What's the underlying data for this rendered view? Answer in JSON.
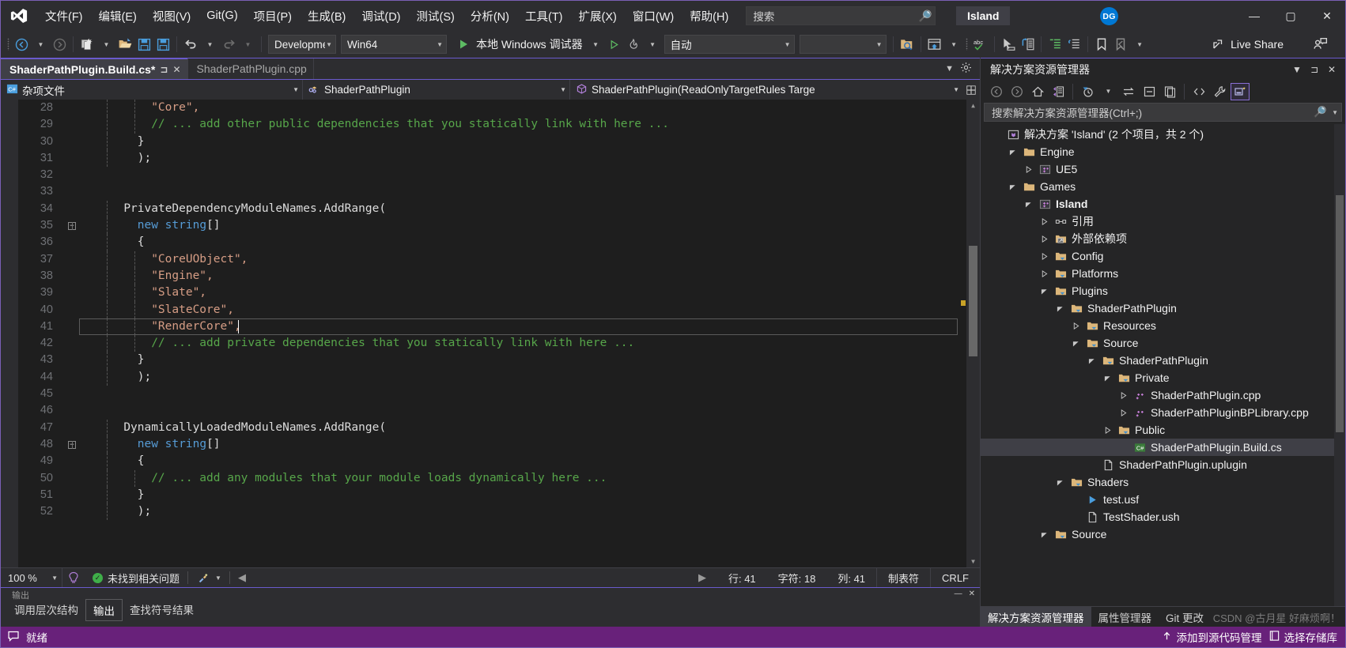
{
  "window": {
    "project_chip": "Island",
    "avatar_initials": "DG",
    "minimize": "—",
    "maximize": "▢",
    "close": "✕"
  },
  "menu": {
    "items": [
      {
        "label": "文件(F)",
        "acc": "F"
      },
      {
        "label": "编辑(E)",
        "acc": "E"
      },
      {
        "label": "视图(V)",
        "acc": "V"
      },
      {
        "label": "Git(G)",
        "acc": "G"
      },
      {
        "label": "项目(P)",
        "acc": "P"
      },
      {
        "label": "生成(B)",
        "acc": "B"
      },
      {
        "label": "调试(D)",
        "acc": "D"
      },
      {
        "label": "测试(S)",
        "acc": "S"
      },
      {
        "label": "分析(N)",
        "acc": "N"
      },
      {
        "label": "工具(T)",
        "acc": "T"
      },
      {
        "label": "扩展(X)",
        "acc": "X"
      },
      {
        "label": "窗口(W)",
        "acc": "W"
      },
      {
        "label": "帮助(H)",
        "acc": "H"
      }
    ],
    "search_placeholder": "搜索"
  },
  "toolbar": {
    "config": "Development",
    "platform": "Win64",
    "debugger_label": "本地 Windows 调试器",
    "auto_label": "自动",
    "blank_combo": "",
    "live_share": "Live Share"
  },
  "editor_tabs": [
    {
      "label": "ShaderPathPlugin.Build.cs*",
      "active": true,
      "pin": "⊐",
      "close": "✕"
    },
    {
      "label": "ShaderPathPlugin.cpp",
      "active": false
    }
  ],
  "nav_bar": {
    "project": "杂项文件",
    "type": "ShaderPathPlugin",
    "member": "ShaderPathPlugin(ReadOnlyTargetRules Targe"
  },
  "code": {
    "lines": [
      {
        "n": "28",
        "indent": 10,
        "tokens": [
          {
            "t": "\"Core\",",
            "c": "str"
          }
        ],
        "fold": "",
        "modified": false
      },
      {
        "n": "29",
        "indent": 10,
        "tokens": [
          {
            "t": "// ... add other public dependencies that you statically link with here ...",
            "c": "cmt"
          }
        ],
        "fold": "",
        "modified": false
      },
      {
        "n": "30",
        "indent": 8,
        "tokens": [
          {
            "t": "}",
            "c": "pln"
          }
        ],
        "fold": "",
        "modified": false
      },
      {
        "n": "31",
        "indent": 8,
        "tokens": [
          {
            "t": ");",
            "c": "pln"
          }
        ],
        "fold": "",
        "modified": false
      },
      {
        "n": "32",
        "indent": 0,
        "tokens": [],
        "fold": "",
        "modified": false
      },
      {
        "n": "33",
        "indent": 0,
        "tokens": [],
        "fold": "",
        "modified": false
      },
      {
        "n": "34",
        "indent": 6,
        "tokens": [
          {
            "t": "PrivateDependencyModuleNames.AddRange(",
            "c": "pln"
          }
        ],
        "fold": "",
        "modified": false
      },
      {
        "n": "35",
        "indent": 8,
        "tokens": [
          {
            "t": "new string",
            "c": "kw"
          },
          {
            "t": "[]",
            "c": "pln"
          }
        ],
        "fold": "minus",
        "modified": false
      },
      {
        "n": "36",
        "indent": 8,
        "tokens": [
          {
            "t": "{",
            "c": "pln"
          }
        ],
        "fold": "",
        "modified": false
      },
      {
        "n": "37",
        "indent": 10,
        "tokens": [
          {
            "t": "\"CoreUObject\",",
            "c": "str"
          }
        ],
        "fold": "",
        "modified": false
      },
      {
        "n": "38",
        "indent": 10,
        "tokens": [
          {
            "t": "\"Engine\",",
            "c": "str"
          }
        ],
        "fold": "",
        "modified": false
      },
      {
        "n": "39",
        "indent": 10,
        "tokens": [
          {
            "t": "\"Slate\",",
            "c": "str"
          }
        ],
        "fold": "",
        "modified": false
      },
      {
        "n": "40",
        "indent": 10,
        "tokens": [
          {
            "t": "\"SlateCore\",",
            "c": "str"
          }
        ],
        "fold": "",
        "modified": true
      },
      {
        "n": "41",
        "indent": 10,
        "tokens": [
          {
            "t": "\"RenderCore\",",
            "c": "str"
          }
        ],
        "fold": "",
        "modified": true,
        "current": true
      },
      {
        "n": "42",
        "indent": 10,
        "tokens": [
          {
            "t": "// ... add private dependencies that you statically link with here ...",
            "c": "cmt"
          }
        ],
        "fold": "",
        "modified": false
      },
      {
        "n": "43",
        "indent": 8,
        "tokens": [
          {
            "t": "}",
            "c": "pln"
          }
        ],
        "fold": "",
        "modified": false
      },
      {
        "n": "44",
        "indent": 8,
        "tokens": [
          {
            "t": ");",
            "c": "pln"
          }
        ],
        "fold": "",
        "modified": false
      },
      {
        "n": "45",
        "indent": 0,
        "tokens": [],
        "fold": "",
        "modified": false
      },
      {
        "n": "46",
        "indent": 0,
        "tokens": [],
        "fold": "",
        "modified": false
      },
      {
        "n": "47",
        "indent": 6,
        "tokens": [
          {
            "t": "DynamicallyLoadedModuleNames.AddRange(",
            "c": "pln"
          }
        ],
        "fold": "",
        "modified": false
      },
      {
        "n": "48",
        "indent": 8,
        "tokens": [
          {
            "t": "new string",
            "c": "kw"
          },
          {
            "t": "[]",
            "c": "pln"
          }
        ],
        "fold": "minus",
        "modified": false
      },
      {
        "n": "49",
        "indent": 8,
        "tokens": [
          {
            "t": "{",
            "c": "pln"
          }
        ],
        "fold": "",
        "modified": false
      },
      {
        "n": "50",
        "indent": 10,
        "tokens": [
          {
            "t": "// ... add any modules that your module loads dynamically here ...",
            "c": "cmt"
          }
        ],
        "fold": "",
        "modified": false
      },
      {
        "n": "51",
        "indent": 8,
        "tokens": [
          {
            "t": "}",
            "c": "pln"
          }
        ],
        "fold": "",
        "modified": false
      },
      {
        "n": "52",
        "indent": 8,
        "tokens": [
          {
            "t": ");",
            "c": "pln"
          }
        ],
        "fold": "",
        "modified": false
      }
    ]
  },
  "editor_status": {
    "zoom": "100 %",
    "problems": "未找到相关问题",
    "line_label": "行: 41",
    "char_label": "字符: 18",
    "col_label": "列: 41",
    "tabs_label": "制表符",
    "eol": "CRLF"
  },
  "bottom_dock": {
    "ghost": "输出",
    "tabs": [
      {
        "label": "调用层次结构",
        "active": false
      },
      {
        "label": "输出",
        "active": true
      },
      {
        "label": "查找符号结果",
        "active": false
      }
    ]
  },
  "solution_explorer": {
    "title": "解决方案资源管理器",
    "search_placeholder": "搜索解决方案资源管理器(Ctrl+;)",
    "tree": [
      {
        "depth": 0,
        "twisty": "",
        "icon": "solution",
        "label": "解决方案 'Island' (2 个项目，共 2 个)",
        "bold": false,
        "selected": false
      },
      {
        "depth": 1,
        "twisty": "open",
        "icon": "folder",
        "label": "Engine",
        "bold": false,
        "selected": false
      },
      {
        "depth": 2,
        "twisty": "closed",
        "icon": "cpp",
        "label": "UE5",
        "bold": false,
        "selected": false
      },
      {
        "depth": 1,
        "twisty": "open",
        "icon": "folder",
        "label": "Games",
        "bold": false,
        "selected": false
      },
      {
        "depth": 2,
        "twisty": "open",
        "icon": "cpp",
        "label": "Island",
        "bold": true,
        "selected": false
      },
      {
        "depth": 3,
        "twisty": "closed",
        "icon": "reference",
        "label": "引用",
        "bold": false,
        "selected": false
      },
      {
        "depth": 3,
        "twisty": "closed",
        "icon": "extdeps",
        "label": "外部依赖项",
        "bold": false,
        "selected": false
      },
      {
        "depth": 3,
        "twisty": "closed",
        "icon": "folderspec",
        "label": "Config",
        "bold": false,
        "selected": false
      },
      {
        "depth": 3,
        "twisty": "closed",
        "icon": "folderspec",
        "label": "Platforms",
        "bold": false,
        "selected": false
      },
      {
        "depth": 3,
        "twisty": "open",
        "icon": "folderspec",
        "label": "Plugins",
        "bold": false,
        "selected": false
      },
      {
        "depth": 4,
        "twisty": "open",
        "icon": "folderspec",
        "label": "ShaderPathPlugin",
        "bold": false,
        "selected": false
      },
      {
        "depth": 5,
        "twisty": "closed",
        "icon": "folderspec",
        "label": "Resources",
        "bold": false,
        "selected": false
      },
      {
        "depth": 5,
        "twisty": "open",
        "icon": "folderspec",
        "label": "Source",
        "bold": false,
        "selected": false
      },
      {
        "depth": 6,
        "twisty": "open",
        "icon": "folderspec",
        "label": "ShaderPathPlugin",
        "bold": false,
        "selected": false
      },
      {
        "depth": 7,
        "twisty": "open",
        "icon": "folderspec",
        "label": "Private",
        "bold": false,
        "selected": false
      },
      {
        "depth": 8,
        "twisty": "closed",
        "icon": "cppfile",
        "label": "ShaderPathPlugin.cpp",
        "bold": false,
        "selected": false
      },
      {
        "depth": 8,
        "twisty": "closed",
        "icon": "cppfile",
        "label": "ShaderPathPluginBPLibrary.cpp",
        "bold": false,
        "selected": false
      },
      {
        "depth": 7,
        "twisty": "closed",
        "icon": "folderspec",
        "label": "Public",
        "bold": false,
        "selected": false
      },
      {
        "depth": 8,
        "twisty": "",
        "icon": "csfile",
        "label": "ShaderPathPlugin.Build.cs",
        "bold": false,
        "selected": true
      },
      {
        "depth": 6,
        "twisty": "",
        "icon": "file",
        "label": "ShaderPathPlugin.uplugin",
        "bold": false,
        "selected": false
      },
      {
        "depth": 4,
        "twisty": "open",
        "icon": "folderspec",
        "label": "Shaders",
        "bold": false,
        "selected": false
      },
      {
        "depth": 5,
        "twisty": "",
        "icon": "usf",
        "label": "test.usf",
        "bold": false,
        "selected": false
      },
      {
        "depth": 5,
        "twisty": "",
        "icon": "file",
        "label": "TestShader.ush",
        "bold": false,
        "selected": false
      },
      {
        "depth": 3,
        "twisty": "open",
        "icon": "folderspec",
        "label": "Source",
        "bold": false,
        "selected": false
      }
    ],
    "bottom_tabs": [
      {
        "label": "解决方案资源管理器",
        "active": true
      },
      {
        "label": "属性管理器",
        "active": false
      },
      {
        "label": "Git 更改",
        "active": false
      }
    ]
  },
  "statusbar": {
    "ready": "就绪",
    "source_control": "添加到源代码管理",
    "repo": "选择存储库"
  },
  "watermark": {
    "text": "CSDN @古月星 好麻烦啊！"
  },
  "colors": {
    "accent_purple": "#68217a",
    "tab_border": "#6a5acd",
    "string": "#d69d85",
    "comment": "#57a64a",
    "keyword": "#569cd6",
    "brand_blue": "#0078d4",
    "folder_gold": "#dcb67a",
    "modified_marker": "#c9a227"
  }
}
